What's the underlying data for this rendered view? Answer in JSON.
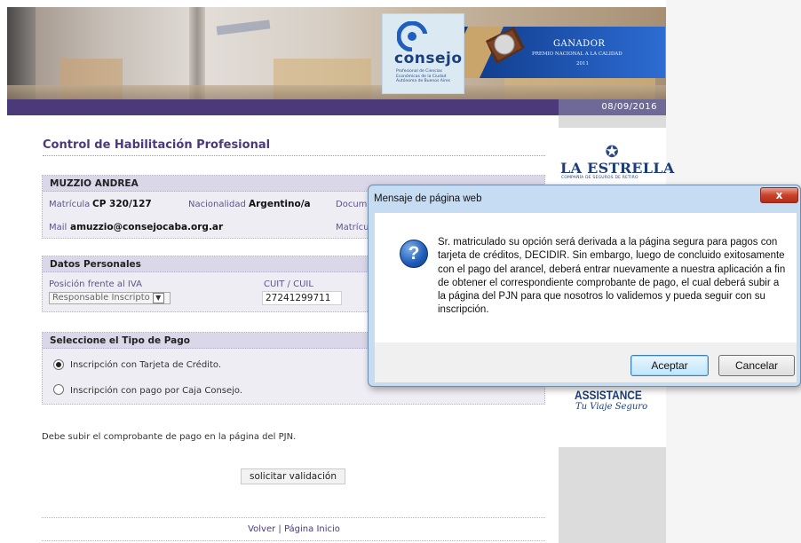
{
  "header": {
    "logo_name": "consejo",
    "logo_subtitle": "Profesional de Ciencias Económicas de la Ciudad Autónoma de Buenos Aires",
    "award_title": "GANADOR",
    "award_subtitle": "PREMIO NACIONAL A LA CALIDAD",
    "award_year": "2011",
    "date": "08/09/2016"
  },
  "sidebar_ads": {
    "estrella_name": "LA ESTRELLA",
    "estrella_sub": "COMPAÑÍA DE SEGUROS DE RETIRO",
    "assistance_name": "ASSISTANCE",
    "assistance_tagline": "Tu Viaje Seguro"
  },
  "form": {
    "title": "Control de Habilitación Profesional",
    "person": {
      "name": "MUZZIO ANDREA",
      "matricula_label": "Matrícula",
      "matricula_value": "CP 320/127",
      "nacionalidad_label": "Nacionalidad",
      "nacionalidad_value": "Argentino/a",
      "documento_label": "Docum",
      "mail_label": "Mail",
      "mail_value": "amuzzio@consejocaba.org.ar",
      "matricula2_label": "Matrícu"
    },
    "datos": {
      "heading": "Datos Personales",
      "iva_label": "Posición frente al IVA",
      "iva_value": "Responsable Inscripto",
      "cuit_label": "CUIT / CUIL",
      "cuit_value": "27241299711"
    },
    "pago": {
      "heading": "Seleccione el Tipo de Pago",
      "options": [
        {
          "label": "Inscripción con Tarjeta de Crédito.",
          "selected": true
        },
        {
          "label": "Inscripción con pago por Caja Consejo.",
          "selected": false
        }
      ]
    },
    "note": "Debe subir el comprobante de pago en la página del PJN.",
    "submit_label": "solicitar validación",
    "footer_links": {
      "volver": "Volver",
      "separator": "|",
      "inicio": "Página Inicio"
    }
  },
  "dialog": {
    "title": "Mensaje de página web",
    "close_glyph": "x",
    "icon_glyph": "?",
    "message": "Sr. matriculado su opción será derivada a la página segura para pagos con tarjeta de créditos, DECIDIR. Sin embargo, luego de concluido exitosamente con el pago del arancel, deberá entrar nuevamente a nuestra aplicación a fin de obtener el correspondiente comprobante de pago, el cual deberá subir a la página del PJN para que nosotros lo validemos y pueda seguir con su inscripción.",
    "ok_label": "Aceptar",
    "cancel_label": "Cancelar"
  }
}
